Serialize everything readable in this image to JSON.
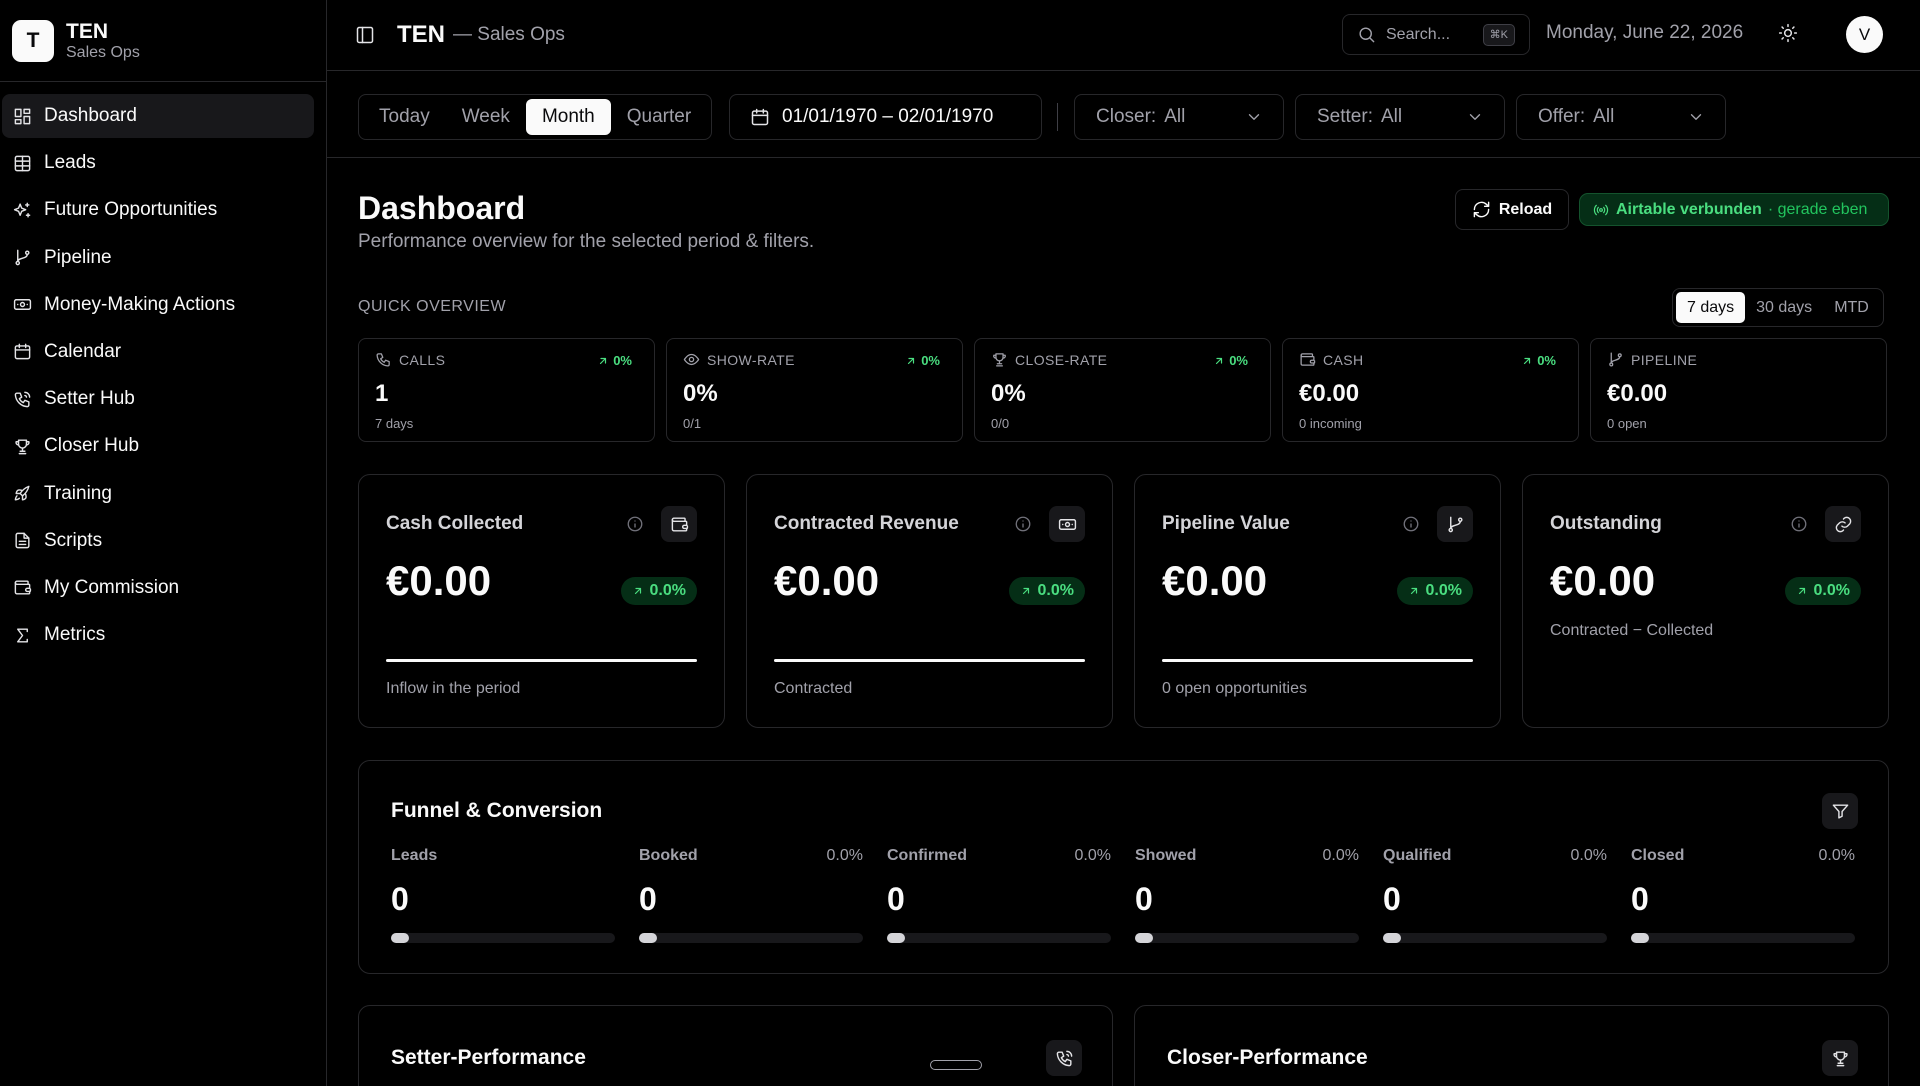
{
  "brand": {
    "logo_letter": "T",
    "name": "TEN",
    "sub": "Sales Ops"
  },
  "sidebar": {
    "items": [
      {
        "label": "Dashboard",
        "icon": "layout-dashboard-icon",
        "active": true
      },
      {
        "label": "Leads",
        "icon": "table-icon"
      },
      {
        "label": "Future Opportunities",
        "icon": "sparkles-icon"
      },
      {
        "label": "Pipeline",
        "icon": "git-branch-icon"
      },
      {
        "label": "Money-Making Actions",
        "icon": "banknote-icon"
      },
      {
        "label": "Calendar",
        "icon": "calendar-icon"
      },
      {
        "label": "Setter Hub",
        "icon": "phone-call-icon"
      },
      {
        "label": "Closer Hub",
        "icon": "trophy-icon"
      },
      {
        "label": "Training",
        "icon": "rocket-icon"
      },
      {
        "label": "Scripts",
        "icon": "file-text-icon"
      },
      {
        "label": "My Commission",
        "icon": "wallet-icon"
      },
      {
        "label": "Metrics",
        "icon": "sigma-icon"
      }
    ]
  },
  "topbar": {
    "title": "TEN",
    "subtitle": "— Sales Ops",
    "search_placeholder": "Search...",
    "search_shortcut": "⌘K",
    "date": "Monday, June 22, 2026",
    "avatar_initial": "V"
  },
  "filters": {
    "periods": [
      "Today",
      "Week",
      "Month",
      "Quarter"
    ],
    "active_period": "Month",
    "date_range": "01/01/1970 – 02/01/1970",
    "closer": {
      "label": "Closer:",
      "value": "All"
    },
    "setter": {
      "label": "Setter:",
      "value": "All"
    },
    "offer": {
      "label": "Offer:",
      "value": "All"
    }
  },
  "page": {
    "title": "Dashboard",
    "subtitle": "Performance overview for the selected period & filters.",
    "reload_label": "Reload",
    "status_text": "Airtable verbunden",
    "status_time": "· gerade eben"
  },
  "quick_overview": {
    "label": "QUICK OVERVIEW",
    "ranges": [
      "7 days",
      "30 days",
      "MTD"
    ],
    "active_range": "7 days",
    "kpis": [
      {
        "label": "CALLS",
        "icon": "phone-icon",
        "delta": "0%",
        "value": "1",
        "sub": "7 days"
      },
      {
        "label": "SHOW-RATE",
        "icon": "eye-icon",
        "delta": "0%",
        "value": "0%",
        "sub": "0/1"
      },
      {
        "label": "CLOSE-RATE",
        "icon": "trophy-icon",
        "delta": "0%",
        "value": "0%",
        "sub": "0/0"
      },
      {
        "label": "CASH",
        "icon": "wallet-icon",
        "delta": "0%",
        "value": "€0.00",
        "sub": "0 incoming"
      },
      {
        "label": "PIPELINE",
        "icon": "git-branch-icon",
        "delta": "",
        "value": "€0.00",
        "sub": "0 open"
      }
    ]
  },
  "cards": [
    {
      "title": "Cash Collected",
      "icon": "wallet-icon",
      "value": "€0.00",
      "delta": "0.0%",
      "foot": "Inflow in the period",
      "line": true
    },
    {
      "title": "Contracted Revenue",
      "icon": "banknote-icon",
      "value": "€0.00",
      "delta": "0.0%",
      "foot": "Contracted",
      "line": true
    },
    {
      "title": "Pipeline Value",
      "icon": "git-branch-icon",
      "value": "€0.00",
      "delta": "0.0%",
      "foot": "0 open opportunities",
      "line": true
    },
    {
      "title": "Outstanding",
      "icon": "link-icon",
      "value": "€0.00",
      "delta": "0.0%",
      "foot": "Contracted − Collected",
      "line": false
    }
  ],
  "funnel": {
    "title": "Funnel & Conversion",
    "stages": [
      {
        "name": "Leads",
        "pct": "",
        "value": "0"
      },
      {
        "name": "Booked",
        "pct": "0.0%",
        "value": "0"
      },
      {
        "name": "Confirmed",
        "pct": "0.0%",
        "value": "0"
      },
      {
        "name": "Showed",
        "pct": "0.0%",
        "value": "0"
      },
      {
        "name": "Qualified",
        "pct": "0.0%",
        "value": "0"
      },
      {
        "name": "Closed",
        "pct": "0.0%",
        "value": "0"
      }
    ]
  },
  "performance": {
    "setter_title": "Setter-Performance",
    "closer_title": "Closer-Performance"
  },
  "colors": {
    "accent_green": "#4ade80",
    "background": "#000000",
    "border": "#27272a"
  }
}
